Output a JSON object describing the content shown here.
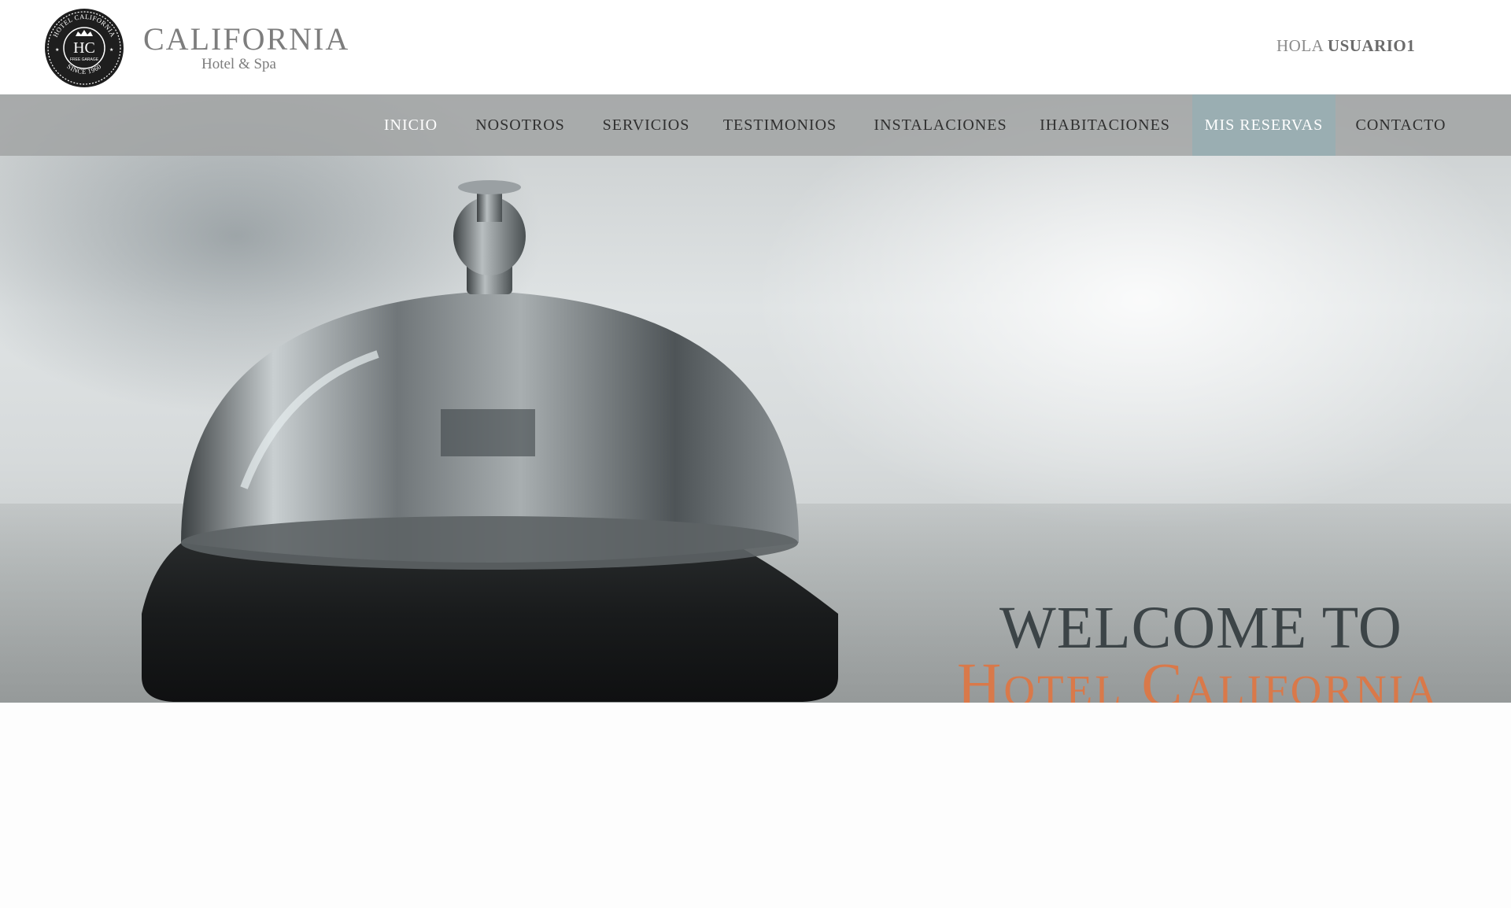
{
  "header": {
    "brand_name": "CALIFORNIA",
    "brand_sub": "Hotel & Spa",
    "seal": {
      "initials": "HC",
      "top_text": "HOTEL CALIFORNIA",
      "bottom_text": "SINCE 1960",
      "small_text": "FREE GARAGE"
    },
    "greeting_prefix": "HOLA",
    "username": "USUARIO1"
  },
  "nav": {
    "items": [
      {
        "label": "INICIO"
      },
      {
        "label": "NOSOTROS"
      },
      {
        "label": "SERVICIOS"
      },
      {
        "label": "TESTIMONIOS"
      },
      {
        "label": "INSTALACIONES"
      },
      {
        "label": "IHABITACIONES"
      },
      {
        "label": "MIS RESERVAS"
      },
      {
        "label": "CONTACTO"
      }
    ],
    "active": "MIS RESERVAS"
  },
  "hero": {
    "line1": "WELCOME TO",
    "line2": "Hotel California",
    "image": "service-bell-photo"
  },
  "colors": {
    "accent": "#d9794a",
    "nav_bar": "#a0a2a2",
    "nav_active": "#9aaeb2",
    "heading_dark": "#3c4447"
  }
}
